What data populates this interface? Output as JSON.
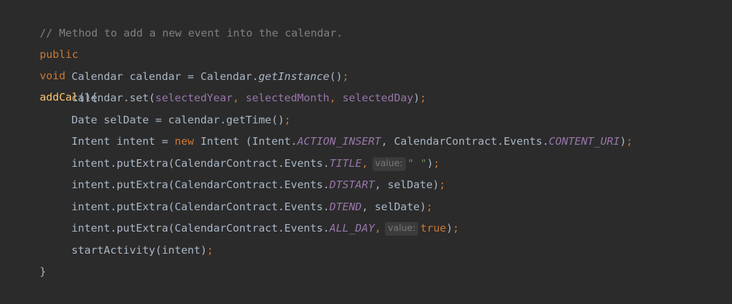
{
  "comment": "// Method to add a new event into the calendar.",
  "signature": {
    "kw_public": "public",
    "kw_void": "void",
    "method": "addCal",
    "tail": "(){"
  },
  "line3": {
    "a": "Calendar calendar = Calendar.",
    "call": "getInstance",
    "b": "()",
    "semi": ";"
  },
  "line4": {
    "a": "calendar.set(",
    "p1": "selectedYear",
    "c1": ", ",
    "p2": "selectedMonth",
    "c2": ", ",
    "p3": "selectedDay",
    "b": ")",
    "semi": ";"
  },
  "line5": {
    "a": "Date selDate = calendar.getTime()",
    "semi": ";"
  },
  "line6": {
    "a": "Intent intent = ",
    "kw_new": "new",
    "b": " Intent (Intent.",
    "c1": "ACTION_INSERT",
    "d": ", CalendarContract.Events.",
    "c2": "CONTENT_URI",
    "e": ")",
    "semi": ";"
  },
  "line7": {
    "a": "intent.putExtra(CalendarContract.Events.",
    "c": "TITLE",
    "comma": ",",
    "hint": "value:",
    "str": "\" \"",
    "e": ")",
    "semi": ";"
  },
  "line8": {
    "a": "intent.putExtra(CalendarContract.Events.",
    "c": "DTSTART",
    "d": ", selDate)",
    "semi": ";"
  },
  "line9": {
    "a": "intent.putExtra(CalendarContract.Events.",
    "c": "DTEND",
    "d": ", selDate)",
    "semi": ";"
  },
  "line10": {
    "a": "intent.putExtra(CalendarContract.Events.",
    "c": "ALL_DAY",
    "comma": ",",
    "hint": "value:",
    "kw_true": "true",
    "e": ")",
    "semi": ";"
  },
  "line11": {
    "a": "startActivity(intent)",
    "semi": ";"
  },
  "closing": "}",
  "colors": {
    "background": "#2b2b2b",
    "default_text": "#a9b7c6",
    "comment": "#808080",
    "keyword": "#cc7832",
    "method_declaration": "#ffc66d",
    "field": "#9876aa",
    "string": "#6a8759",
    "inlay_hint_bg": "#3b3b3b",
    "inlay_hint_text": "#787878"
  }
}
